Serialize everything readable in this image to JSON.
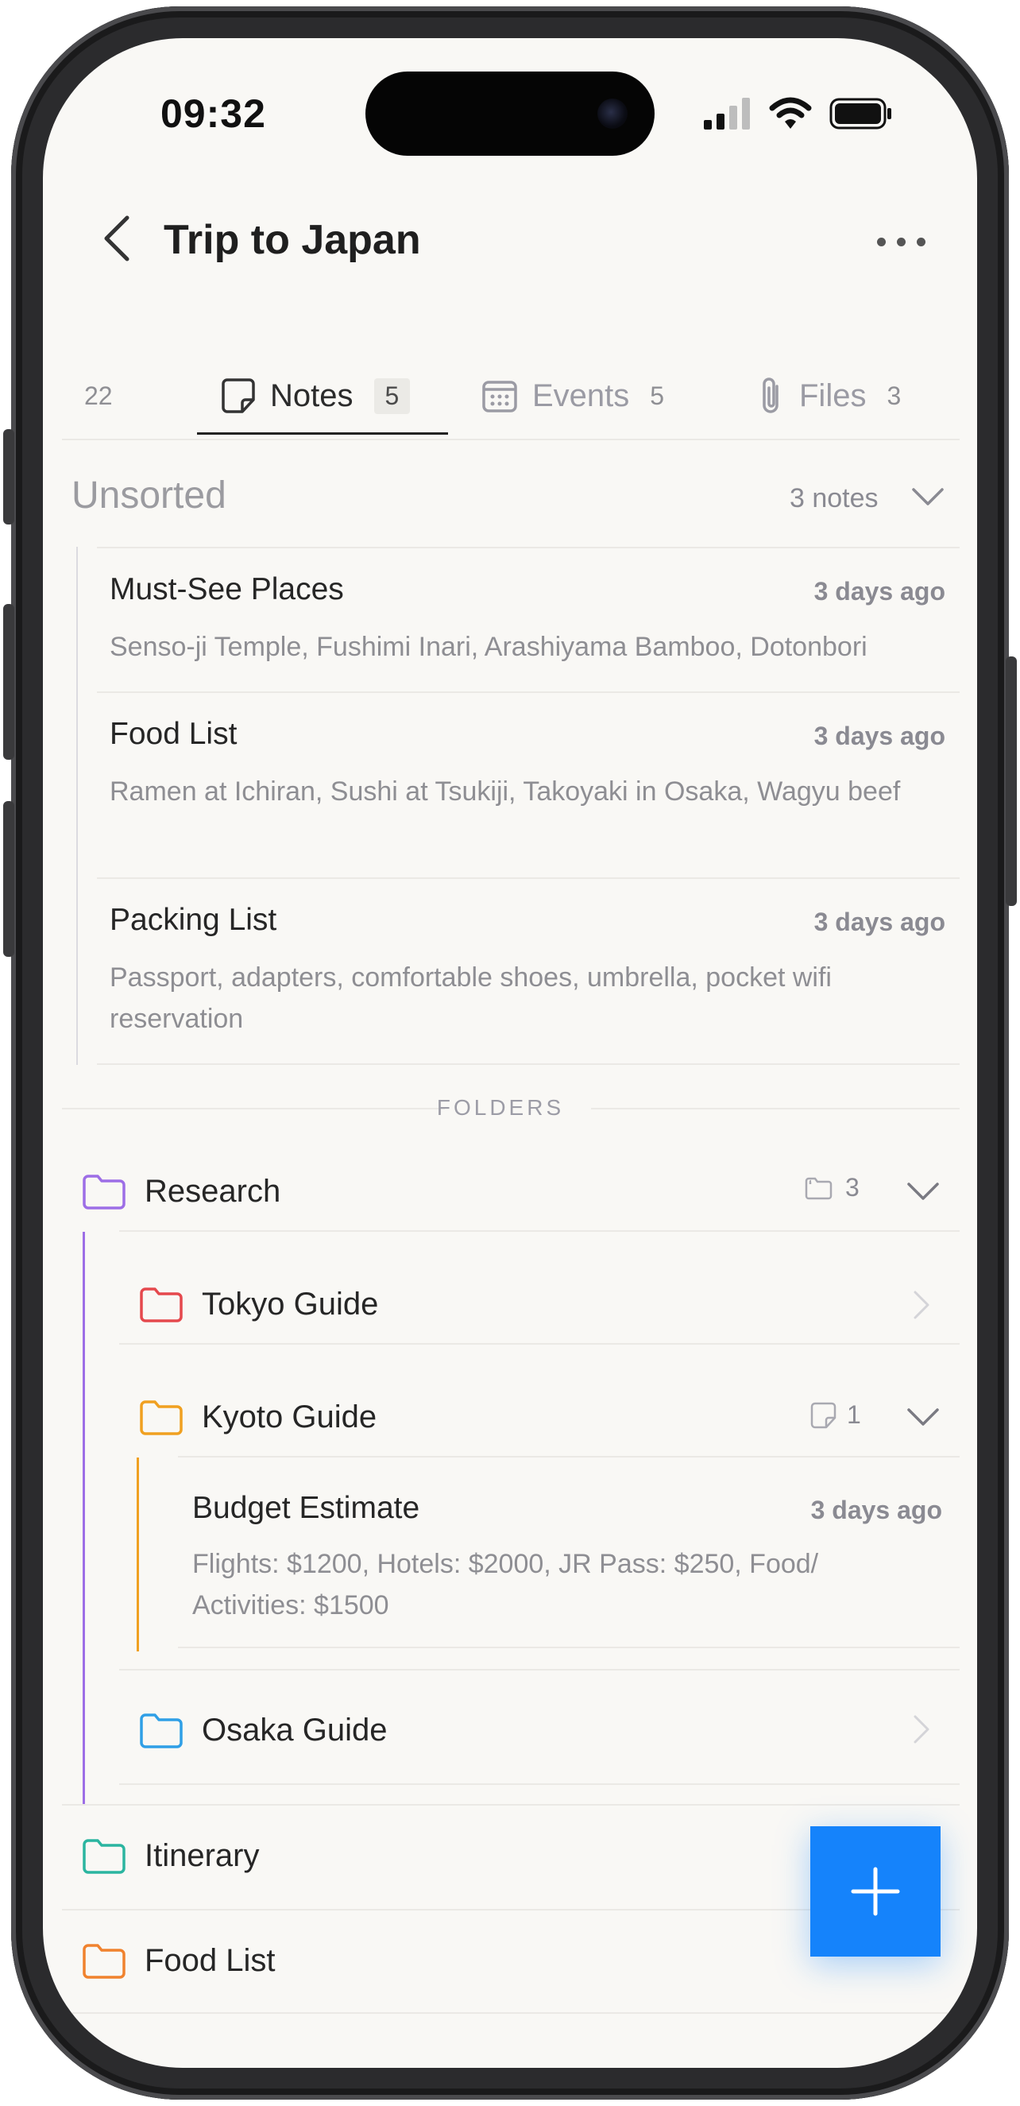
{
  "status_bar": {
    "time": "09:32"
  },
  "nav": {
    "title": "Trip to Japan"
  },
  "tabs": [
    {
      "label": "",
      "count": "22"
    },
    {
      "label": "Notes",
      "count": "5",
      "icon": "note-icon",
      "active": true
    },
    {
      "label": "Events",
      "count": "5",
      "icon": "calendar-icon"
    },
    {
      "label": "Files",
      "count": "3",
      "icon": "paperclip-icon"
    }
  ],
  "unsorted": {
    "title": "Unsorted",
    "count": "3 notes",
    "notes": [
      {
        "title": "Must-See Places",
        "time": "3 days ago",
        "preview": "Senso-ji Temple, Fushimi Inari, Arashiyama Bamboo, Dotonbori"
      },
      {
        "title": "Food List",
        "time": "3 days ago",
        "preview": "Ramen at Ichiran, Sushi at Tsukiji, Takoyaki in Osaka, Wagyu beef"
      },
      {
        "title": "Packing List",
        "time": "3 days ago",
        "preview": "Passport, adapters, comfortable shoes, umbrella, pocket wifi reservation"
      }
    ]
  },
  "folders": {
    "label": "FOLDERS",
    "research": {
      "name": "Research",
      "count": "3",
      "color": "#9d6ee6"
    },
    "tokyo": {
      "name": "Tokyo Guide",
      "color": "#e5484d"
    },
    "kyoto": {
      "name": "Kyoto Guide",
      "count": "1",
      "color": "#f0a020",
      "note": {
        "title": "Budget Estimate",
        "time": "3 days ago",
        "preview": "Flights: $1200, Hotels: $2000, JR Pass: $250, Food/ Activities: $1500"
      }
    },
    "osaka": {
      "name": "Osaka Guide",
      "color": "#2f9fe6"
    },
    "itinerary": {
      "name": "Itinerary",
      "color": "#2bb5a0"
    },
    "food": {
      "name": "Food List",
      "color": "#f0822e"
    }
  },
  "colors": {
    "accent": "#1583fb",
    "background": "#f9f8f5"
  }
}
